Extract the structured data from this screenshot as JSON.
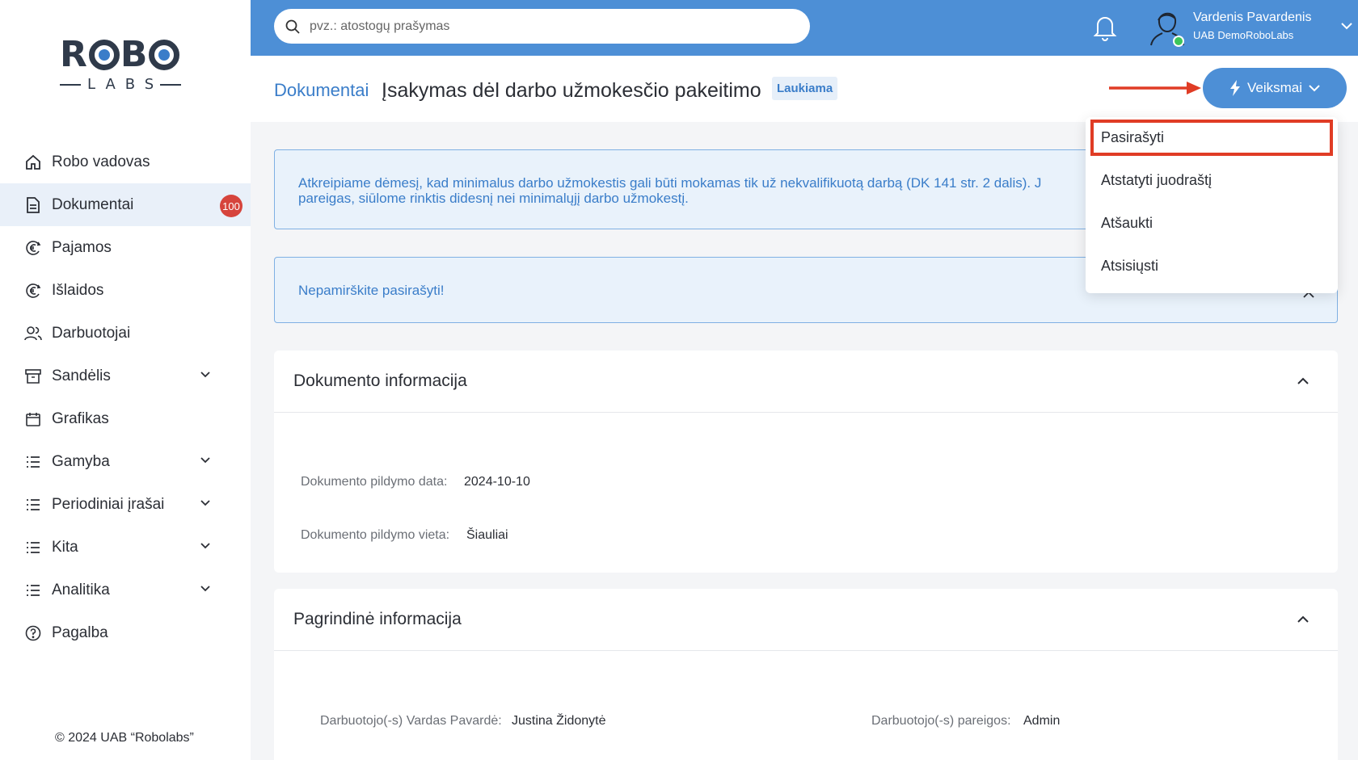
{
  "logo": {
    "top": "ROBO",
    "bottom": "LABS"
  },
  "sidebar": {
    "items": [
      {
        "label": "Robo vadovas",
        "icon": "home-icon"
      },
      {
        "label": "Dokumentai",
        "icon": "document-icon",
        "badge": "100",
        "active": true
      },
      {
        "label": "Pajamos",
        "icon": "euro-income-icon"
      },
      {
        "label": "Išlaidos",
        "icon": "euro-expense-icon"
      },
      {
        "label": "Darbuotojai",
        "icon": "users-icon"
      },
      {
        "label": "Sandėlis",
        "icon": "archive-icon",
        "expandable": true
      },
      {
        "label": "Grafikas",
        "icon": "calendar-icon"
      },
      {
        "label": "Gamyba",
        "icon": "list-icon",
        "expandable": true
      },
      {
        "label": "Periodiniai įrašai",
        "icon": "list-icon",
        "expandable": true
      },
      {
        "label": "Kita",
        "icon": "list-icon",
        "expandable": true
      },
      {
        "label": "Analitika",
        "icon": "list-icon",
        "expandable": true
      },
      {
        "label": "Pagalba",
        "icon": "help-icon"
      }
    ],
    "copyright": "© 2024 UAB “Robolabs”"
  },
  "topbar": {
    "search_placeholder": "pvz.: atostogų prašymas",
    "user_name": "Vardenis Pavardenis",
    "user_company": "UAB DemoRoboLabs"
  },
  "header": {
    "breadcrumb": "Dokumentai",
    "title": "Įsakymas dėl darbo užmokesčio pakeitimo",
    "status": "Laukiama",
    "actions_label": "Veiksmai"
  },
  "alerts": {
    "warning_line1": "Atkreipiame dėmesį, kad minimalus darbo užmokestis gali būti mokamas tik už nekvalifikuotą darbą (DK 141 str. 2 dalis). J",
    "warning_line2": "pareigas, siūlome rinktis didesnį nei minimalųjį darbo užmokestį.",
    "reminder": "Nepamirškite pasirašyti!"
  },
  "document_info": {
    "title": "Dokumento informacija",
    "date_label": "Dokumento pildymo data:",
    "date_value": "2024-10-10",
    "place_label": "Dokumento pildymo vieta:",
    "place_value": "Šiauliai"
  },
  "main_info": {
    "title": "Pagrindinė informacija",
    "employee_label": "Darbuotojo(-s) Vardas Pavardė:",
    "employee_value": "Justina Židonytė",
    "position_label": "Darbuotojo(-s) pareigos:",
    "position_value": "Admin"
  },
  "dropdown": {
    "items": [
      "Pasirašyti",
      "Atstatyti juodraštį",
      "Atšaukti",
      "Atsisiųsti"
    ],
    "highlighted": "Pasirašyti"
  },
  "colors": {
    "accent": "#4d8fd6",
    "badge": "#d6443c",
    "highlight": "#e03c25",
    "online": "#3cc65a"
  }
}
